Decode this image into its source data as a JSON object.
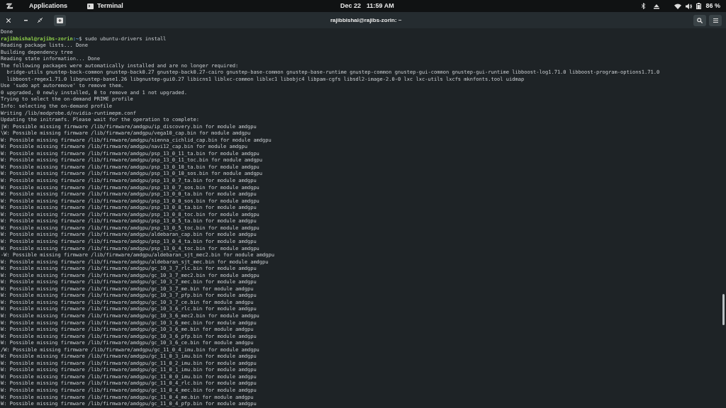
{
  "top_panel": {
    "applications": "Applications",
    "app": "Terminal",
    "date": "Dec 22",
    "time": "11:59 AM",
    "battery": "86 %"
  },
  "window": {
    "title": "rajibbishal@rajibs-zorin: ~"
  },
  "terminal": {
    "lines": [
      {
        "kind": "output",
        "text": "Done"
      },
      {
        "kind": "prompt",
        "user_host": "rajibbishal@rajibs-zorin",
        "path": ":~",
        "command": "$ sudo ubuntu-drivers install"
      },
      {
        "kind": "output",
        "text": "Reading package lists... Done"
      },
      {
        "kind": "output",
        "text": "Building dependency tree"
      },
      {
        "kind": "output",
        "text": "Reading state information... Done"
      },
      {
        "kind": "output",
        "text": "The following packages were automatically installed and are no longer required:"
      },
      {
        "kind": "output",
        "text": "  bridge-utils gnustep-back-common gnustep-back0.27 gnustep-back0.27-cairo gnustep-base-common gnustep-base-runtime gnustep-common gnustep-gui-common gnustep-gui-runtime libboost-log1.71.0 libboost-program-options1.71.0"
      },
      {
        "kind": "output",
        "text": "  libboost-regex1.71.0 libgnustep-base1.26 libgnustep-gui0.27 libicns1 liblxc-common liblxc1 libobjc4 libpam-cgfs libsdl2-image-2.0-0 lxc lxc-utils lxcfs mknfonts.tool uidmap"
      },
      {
        "kind": "output",
        "text": "Use 'sudo apt autoremove' to remove them."
      },
      {
        "kind": "output",
        "text": "0 upgraded, 0 newly installed, 0 to remove and 1 not upgraded."
      },
      {
        "kind": "output",
        "text": "Trying to select the on-demand PRIME profile"
      },
      {
        "kind": "output",
        "text": "Info: selecting the on-demand profile"
      },
      {
        "kind": "output",
        "text": "Writing /lib/modprobe.d/nvidia-runtimepm.conf"
      },
      {
        "kind": "output",
        "text": "Updating the initramfs. Please wait for the operation to complete:"
      },
      {
        "kind": "output",
        "text": "|W: Possible missing firmware /lib/firmware/amdgpu/ip_discovery.bin for module amdgpu"
      },
      {
        "kind": "output",
        "text": "\\W: Possible missing firmware /lib/firmware/amdgpu/vega10_cap.bin for module amdgpu"
      },
      {
        "kind": "output",
        "text": "W: Possible missing firmware /lib/firmware/amdgpu/sienna_cichlid_cap.bin for module amdgpu"
      },
      {
        "kind": "output",
        "text": "W: Possible missing firmware /lib/firmware/amdgpu/navi12_cap.bin for module amdgpu"
      },
      {
        "kind": "output",
        "text": "W: Possible missing firmware /lib/firmware/amdgpu/psp_13_0_11_ta.bin for module amdgpu"
      },
      {
        "kind": "output",
        "text": "W: Possible missing firmware /lib/firmware/amdgpu/psp_13_0_11_toc.bin for module amdgpu"
      },
      {
        "kind": "output",
        "text": "W: Possible missing firmware /lib/firmware/amdgpu/psp_13_0_10_ta.bin for module amdgpu"
      },
      {
        "kind": "output",
        "text": "W: Possible missing firmware /lib/firmware/amdgpu/psp_13_0_10_sos.bin for module amdgpu"
      },
      {
        "kind": "output",
        "text": "W: Possible missing firmware /lib/firmware/amdgpu/psp_13_0_7_ta.bin for module amdgpu"
      },
      {
        "kind": "output",
        "text": "W: Possible missing firmware /lib/firmware/amdgpu/psp_13_0_7_sos.bin for module amdgpu"
      },
      {
        "kind": "output",
        "text": "W: Possible missing firmware /lib/firmware/amdgpu/psp_13_0_0_ta.bin for module amdgpu"
      },
      {
        "kind": "output",
        "text": "W: Possible missing firmware /lib/firmware/amdgpu/psp_13_0_0_sos.bin for module amdgpu"
      },
      {
        "kind": "output",
        "text": "W: Possible missing firmware /lib/firmware/amdgpu/psp_13_0_8_ta.bin for module amdgpu"
      },
      {
        "kind": "output",
        "text": "W: Possible missing firmware /lib/firmware/amdgpu/psp_13_0_8_toc.bin for module amdgpu"
      },
      {
        "kind": "output",
        "text": "W: Possible missing firmware /lib/firmware/amdgpu/psp_13_0_5_ta.bin for module amdgpu"
      },
      {
        "kind": "output",
        "text": "W: Possible missing firmware /lib/firmware/amdgpu/psp_13_0_5_toc.bin for module amdgpu"
      },
      {
        "kind": "output",
        "text": "W: Possible missing firmware /lib/firmware/amdgpu/aldebaran_cap.bin for module amdgpu"
      },
      {
        "kind": "output",
        "text": "W: Possible missing firmware /lib/firmware/amdgpu/psp_13_0_4_ta.bin for module amdgpu"
      },
      {
        "kind": "output",
        "text": "W: Possible missing firmware /lib/firmware/amdgpu/psp_13_0_4_toc.bin for module amdgpu"
      },
      {
        "kind": "output",
        "text": "-W: Possible missing firmware /lib/firmware/amdgpu/aldebaran_sjt_mec2.bin for module amdgpu"
      },
      {
        "kind": "output",
        "text": "W: Possible missing firmware /lib/firmware/amdgpu/aldebaran_sjt_mec.bin for module amdgpu"
      },
      {
        "kind": "output",
        "text": "W: Possible missing firmware /lib/firmware/amdgpu/gc_10_3_7_rlc.bin for module amdgpu"
      },
      {
        "kind": "output",
        "text": "W: Possible missing firmware /lib/firmware/amdgpu/gc_10_3_7_mec2.bin for module amdgpu"
      },
      {
        "kind": "output",
        "text": "W: Possible missing firmware /lib/firmware/amdgpu/gc_10_3_7_mec.bin for module amdgpu"
      },
      {
        "kind": "output",
        "text": "W: Possible missing firmware /lib/firmware/amdgpu/gc_10_3_7_me.bin for module amdgpu"
      },
      {
        "kind": "output",
        "text": "W: Possible missing firmware /lib/firmware/amdgpu/gc_10_3_7_pfp.bin for module amdgpu"
      },
      {
        "kind": "output",
        "text": "W: Possible missing firmware /lib/firmware/amdgpu/gc_10_3_7_ce.bin for module amdgpu"
      },
      {
        "kind": "output",
        "text": "W: Possible missing firmware /lib/firmware/amdgpu/gc_10_3_6_rlc.bin for module amdgpu"
      },
      {
        "kind": "output",
        "text": "W: Possible missing firmware /lib/firmware/amdgpu/gc_10_3_6_mec2.bin for module amdgpu"
      },
      {
        "kind": "output",
        "text": "W: Possible missing firmware /lib/firmware/amdgpu/gc_10_3_6_mec.bin for module amdgpu"
      },
      {
        "kind": "output",
        "text": "W: Possible missing firmware /lib/firmware/amdgpu/gc_10_3_6_me.bin for module amdgpu"
      },
      {
        "kind": "output",
        "text": "W: Possible missing firmware /lib/firmware/amdgpu/gc_10_3_6_pfp.bin for module amdgpu"
      },
      {
        "kind": "output",
        "text": "W: Possible missing firmware /lib/firmware/amdgpu/gc_10_3_6_ce.bin for module amdgpu"
      },
      {
        "kind": "output",
        "text": "/W: Possible missing firmware /lib/firmware/amdgpu/gc_11_0_4_imu.bin for module amdgpu"
      },
      {
        "kind": "output",
        "text": "W: Possible missing firmware /lib/firmware/amdgpu/gc_11_0_3_imu.bin for module amdgpu"
      },
      {
        "kind": "output",
        "text": "W: Possible missing firmware /lib/firmware/amdgpu/gc_11_0_2_imu.bin for module amdgpu"
      },
      {
        "kind": "output",
        "text": "W: Possible missing firmware /lib/firmware/amdgpu/gc_11_0_1_imu.bin for module amdgpu"
      },
      {
        "kind": "output",
        "text": "W: Possible missing firmware /lib/firmware/amdgpu/gc_11_0_0_imu.bin for module amdgpu"
      },
      {
        "kind": "output",
        "text": "W: Possible missing firmware /lib/firmware/amdgpu/gc_11_0_4_rlc.bin for module amdgpu"
      },
      {
        "kind": "output",
        "text": "W: Possible missing firmware /lib/firmware/amdgpu/gc_11_0_4_mec.bin for module amdgpu"
      },
      {
        "kind": "output",
        "text": "W: Possible missing firmware /lib/firmware/amdgpu/gc_11_0_4_me.bin for module amdgpu"
      },
      {
        "kind": "output",
        "text": "W: Possible missing firmware /lib/firmware/amdgpu/gc_11_0_4_pfp.bin for module amdgpu"
      }
    ]
  }
}
